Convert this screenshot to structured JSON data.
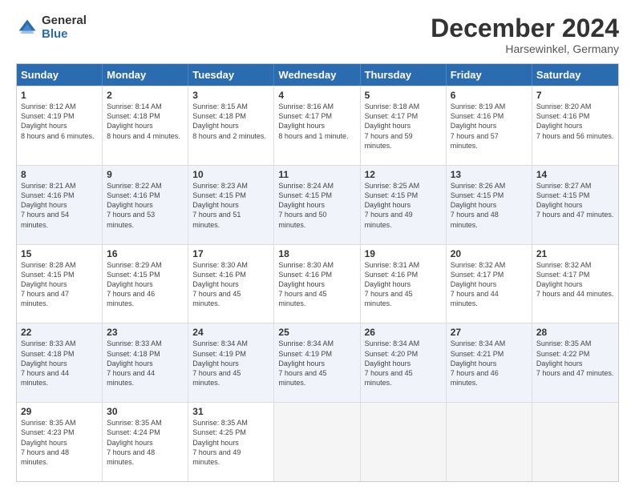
{
  "logo": {
    "general": "General",
    "blue": "Blue"
  },
  "title": "December 2024",
  "location": "Harsewinkel, Germany",
  "days_of_week": [
    "Sunday",
    "Monday",
    "Tuesday",
    "Wednesday",
    "Thursday",
    "Friday",
    "Saturday"
  ],
  "weeks": [
    [
      {
        "day": "1",
        "sunrise": "8:12 AM",
        "sunset": "4:19 PM",
        "daylight": "8 hours and 6 minutes."
      },
      {
        "day": "2",
        "sunrise": "8:14 AM",
        "sunset": "4:18 PM",
        "daylight": "8 hours and 4 minutes."
      },
      {
        "day": "3",
        "sunrise": "8:15 AM",
        "sunset": "4:18 PM",
        "daylight": "8 hours and 2 minutes."
      },
      {
        "day": "4",
        "sunrise": "8:16 AM",
        "sunset": "4:17 PM",
        "daylight": "8 hours and 1 minute."
      },
      {
        "day": "5",
        "sunrise": "8:18 AM",
        "sunset": "4:17 PM",
        "daylight": "7 hours and 59 minutes."
      },
      {
        "day": "6",
        "sunrise": "8:19 AM",
        "sunset": "4:16 PM",
        "daylight": "7 hours and 57 minutes."
      },
      {
        "day": "7",
        "sunrise": "8:20 AM",
        "sunset": "4:16 PM",
        "daylight": "7 hours and 56 minutes."
      }
    ],
    [
      {
        "day": "8",
        "sunrise": "8:21 AM",
        "sunset": "4:16 PM",
        "daylight": "7 hours and 54 minutes."
      },
      {
        "day": "9",
        "sunrise": "8:22 AM",
        "sunset": "4:16 PM",
        "daylight": "7 hours and 53 minutes."
      },
      {
        "day": "10",
        "sunrise": "8:23 AM",
        "sunset": "4:15 PM",
        "daylight": "7 hours and 51 minutes."
      },
      {
        "day": "11",
        "sunrise": "8:24 AM",
        "sunset": "4:15 PM",
        "daylight": "7 hours and 50 minutes."
      },
      {
        "day": "12",
        "sunrise": "8:25 AM",
        "sunset": "4:15 PM",
        "daylight": "7 hours and 49 minutes."
      },
      {
        "day": "13",
        "sunrise": "8:26 AM",
        "sunset": "4:15 PM",
        "daylight": "7 hours and 48 minutes."
      },
      {
        "day": "14",
        "sunrise": "8:27 AM",
        "sunset": "4:15 PM",
        "daylight": "7 hours and 47 minutes."
      }
    ],
    [
      {
        "day": "15",
        "sunrise": "8:28 AM",
        "sunset": "4:15 PM",
        "daylight": "7 hours and 47 minutes."
      },
      {
        "day": "16",
        "sunrise": "8:29 AM",
        "sunset": "4:15 PM",
        "daylight": "7 hours and 46 minutes."
      },
      {
        "day": "17",
        "sunrise": "8:30 AM",
        "sunset": "4:16 PM",
        "daylight": "7 hours and 45 minutes."
      },
      {
        "day": "18",
        "sunrise": "8:30 AM",
        "sunset": "4:16 PM",
        "daylight": "7 hours and 45 minutes."
      },
      {
        "day": "19",
        "sunrise": "8:31 AM",
        "sunset": "4:16 PM",
        "daylight": "7 hours and 45 minutes."
      },
      {
        "day": "20",
        "sunrise": "8:32 AM",
        "sunset": "4:17 PM",
        "daylight": "7 hours and 44 minutes."
      },
      {
        "day": "21",
        "sunrise": "8:32 AM",
        "sunset": "4:17 PM",
        "daylight": "7 hours and 44 minutes."
      }
    ],
    [
      {
        "day": "22",
        "sunrise": "8:33 AM",
        "sunset": "4:18 PM",
        "daylight": "7 hours and 44 minutes."
      },
      {
        "day": "23",
        "sunrise": "8:33 AM",
        "sunset": "4:18 PM",
        "daylight": "7 hours and 44 minutes."
      },
      {
        "day": "24",
        "sunrise": "8:34 AM",
        "sunset": "4:19 PM",
        "daylight": "7 hours and 45 minutes."
      },
      {
        "day": "25",
        "sunrise": "8:34 AM",
        "sunset": "4:19 PM",
        "daylight": "7 hours and 45 minutes."
      },
      {
        "day": "26",
        "sunrise": "8:34 AM",
        "sunset": "4:20 PM",
        "daylight": "7 hours and 45 minutes."
      },
      {
        "day": "27",
        "sunrise": "8:34 AM",
        "sunset": "4:21 PM",
        "daylight": "7 hours and 46 minutes."
      },
      {
        "day": "28",
        "sunrise": "8:35 AM",
        "sunset": "4:22 PM",
        "daylight": "7 hours and 47 minutes."
      }
    ],
    [
      {
        "day": "29",
        "sunrise": "8:35 AM",
        "sunset": "4:23 PM",
        "daylight": "7 hours and 48 minutes."
      },
      {
        "day": "30",
        "sunrise": "8:35 AM",
        "sunset": "4:24 PM",
        "daylight": "7 hours and 48 minutes."
      },
      {
        "day": "31",
        "sunrise": "8:35 AM",
        "sunset": "4:25 PM",
        "daylight": "7 hours and 49 minutes."
      },
      null,
      null,
      null,
      null
    ]
  ],
  "labels": {
    "sunrise": "Sunrise:",
    "sunset": "Sunset:",
    "daylight": "Daylight hours"
  },
  "row_alt": [
    false,
    true,
    false,
    true,
    false
  ]
}
